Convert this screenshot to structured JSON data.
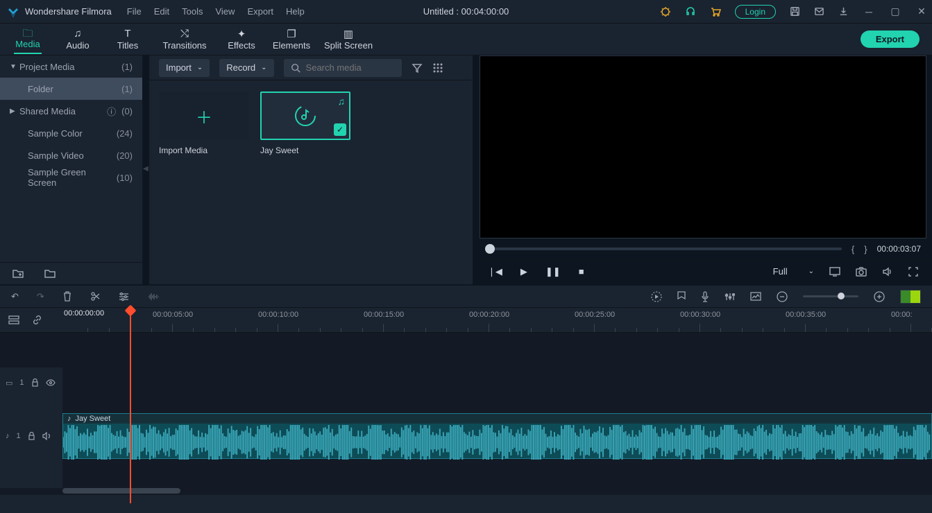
{
  "app": {
    "title": "Wondershare Filmora"
  },
  "menu": [
    "File",
    "Edit",
    "Tools",
    "View",
    "Export",
    "Help"
  ],
  "document": {
    "title": "Untitled : 00:04:00:00"
  },
  "titlebar_right": {
    "login": "Login"
  },
  "ribbon": {
    "items": [
      "Media",
      "Audio",
      "Titles",
      "Transitions",
      "Effects",
      "Elements",
      "Split Screen"
    ],
    "active": 0,
    "export": "Export"
  },
  "sidebar": {
    "rows": [
      {
        "label": "Project Media",
        "count": "(1)",
        "caret": "▼"
      },
      {
        "label": "Folder",
        "count": "(1)",
        "indent": true,
        "selected": true
      },
      {
        "label": "Shared Media",
        "count": "(0)",
        "caret": "▶",
        "info": true
      },
      {
        "label": "Sample Color",
        "count": "(24)",
        "indent": true
      },
      {
        "label": "Sample Video",
        "count": "(20)",
        "indent": true
      },
      {
        "label": "Sample Green Screen",
        "count": "(10)",
        "indent": true
      }
    ]
  },
  "media_toolbar": {
    "import": "Import",
    "record": "Record",
    "search_placeholder": "Search media"
  },
  "media_items": {
    "import_card": "Import Media",
    "clip1": "Jay Sweet"
  },
  "preview": {
    "in_marker": "{",
    "out_marker": "}",
    "time": "00:00:03:07",
    "quality": "Full"
  },
  "ruler": {
    "playhead_tc": "00:00:00:00",
    "labels": [
      "00:00:05:00",
      "00:00:10:00",
      "00:00:15:00",
      "00:00:20:00",
      "00:00:25:00",
      "00:00:30:00",
      "00:00:35:00",
      "00:00:"
    ]
  },
  "tracks": {
    "video1": "1",
    "audio1": "1",
    "clip_name": "Jay Sweet"
  }
}
